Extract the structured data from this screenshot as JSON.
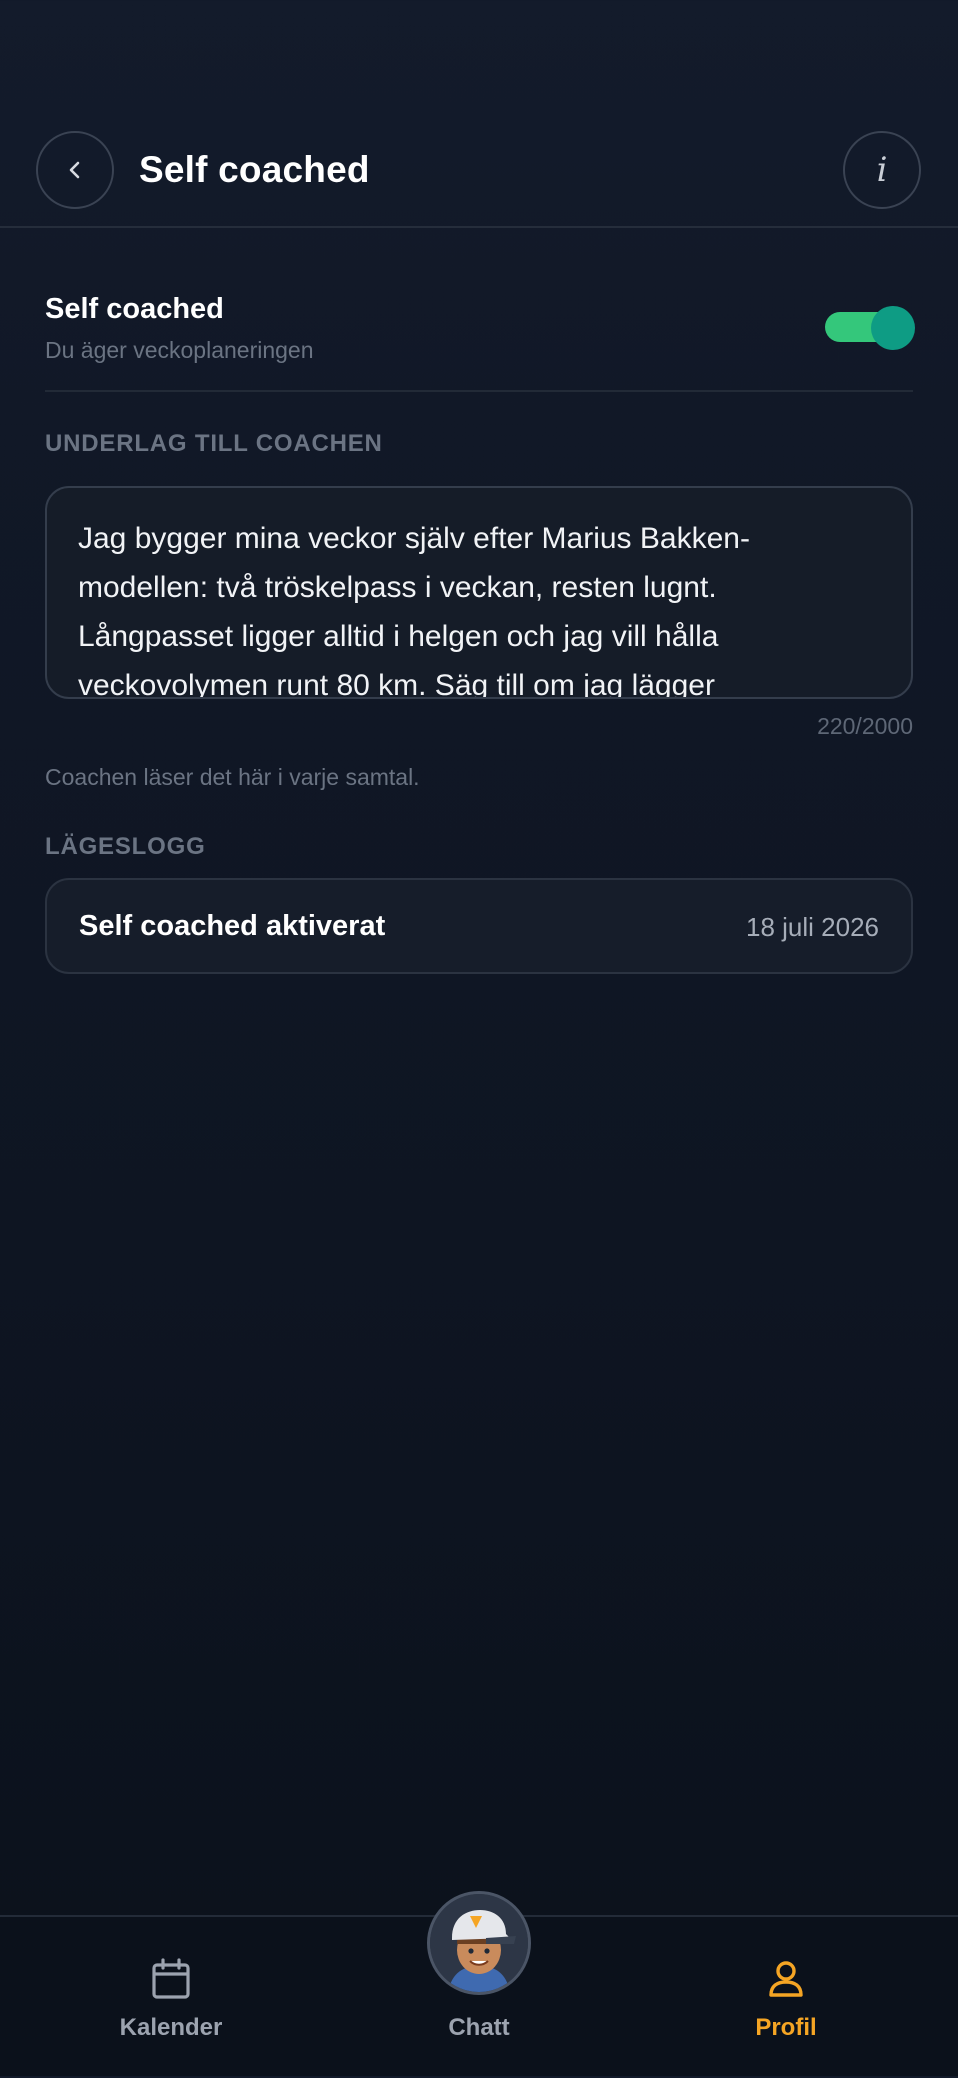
{
  "header": {
    "title": "Self coached",
    "back_icon": "chevron-left-icon",
    "info_label": "i"
  },
  "setting": {
    "title": "Self coached",
    "subtitle": "Du äger veckoplaneringen",
    "toggle_on": true,
    "toggle_color": "#34c77b"
  },
  "notes": {
    "section_label": "UNDERLAG TILL COACHEN",
    "value": "Jag bygger mina veckor själv efter Marius Bakken-modellen: två tröskelpass i veckan, resten lugnt. Långpasset ligger alltid i helgen och jag vill hålla veckovolymen runt 80 km. Säg till om jag lägger",
    "char_count": "220/2000",
    "helper": "Coachen läser det här i varje samtal."
  },
  "log": {
    "section_label": "LÄGESLOGG",
    "items": [
      {
        "title": "Self coached aktiverat",
        "date": "18 juli 2026"
      }
    ]
  },
  "tabbar": {
    "tabs": [
      {
        "label": "Kalender",
        "icon": "calendar-icon"
      },
      {
        "label": "Chatt",
        "icon": "coach-avatar"
      },
      {
        "label": "Profil",
        "icon": "person-icon"
      }
    ],
    "active": "Profil",
    "active_color": "#f5a524"
  }
}
